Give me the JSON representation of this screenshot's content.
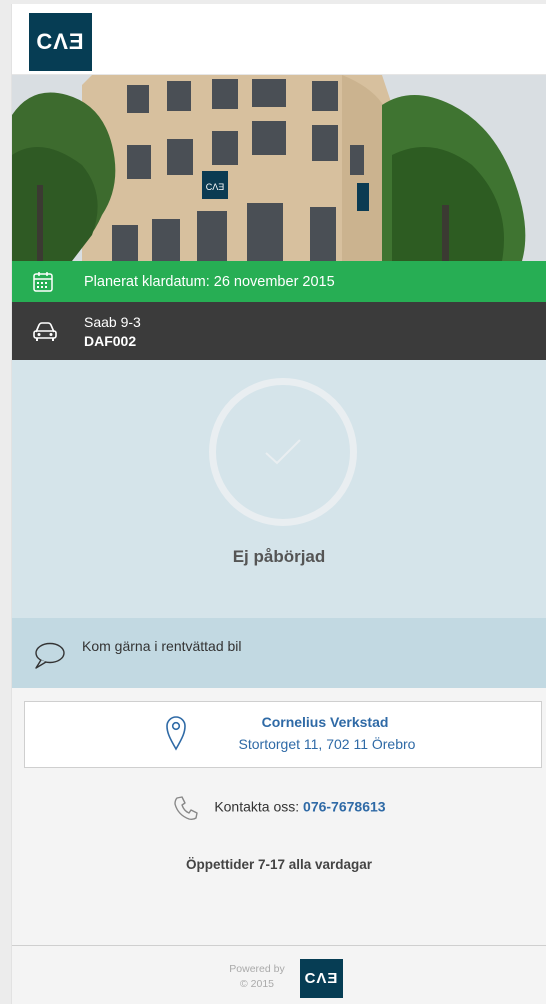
{
  "brand": {
    "logo_text": "CΛƎ",
    "color": "#063d54"
  },
  "schedule": {
    "label": "Planerat klardatum: 26 november 2015",
    "icon": "calendar-icon",
    "color": "#27ae54"
  },
  "vehicle": {
    "model": "Saab 9-3",
    "plate": "DAF002",
    "icon": "car-icon"
  },
  "status": {
    "label": "Ej påbörjad",
    "icon": "check-icon"
  },
  "note": {
    "text": "Kom gärna i rentvättad bil",
    "icon": "speech-bubble-icon"
  },
  "workshop": {
    "name": "Cornelius Verkstad",
    "address": "Stortorget 11, 702 11 Örebro",
    "icon": "location-pin-icon"
  },
  "contact": {
    "label": "Kontakta oss:",
    "phone": "076-7678613",
    "icon": "phone-icon"
  },
  "hours": {
    "text": "Öppettider 7-17 alla vardagar"
  },
  "footer": {
    "powered_by": "Powered by",
    "year": "© 2015",
    "logo_text": "CΛƎ"
  }
}
